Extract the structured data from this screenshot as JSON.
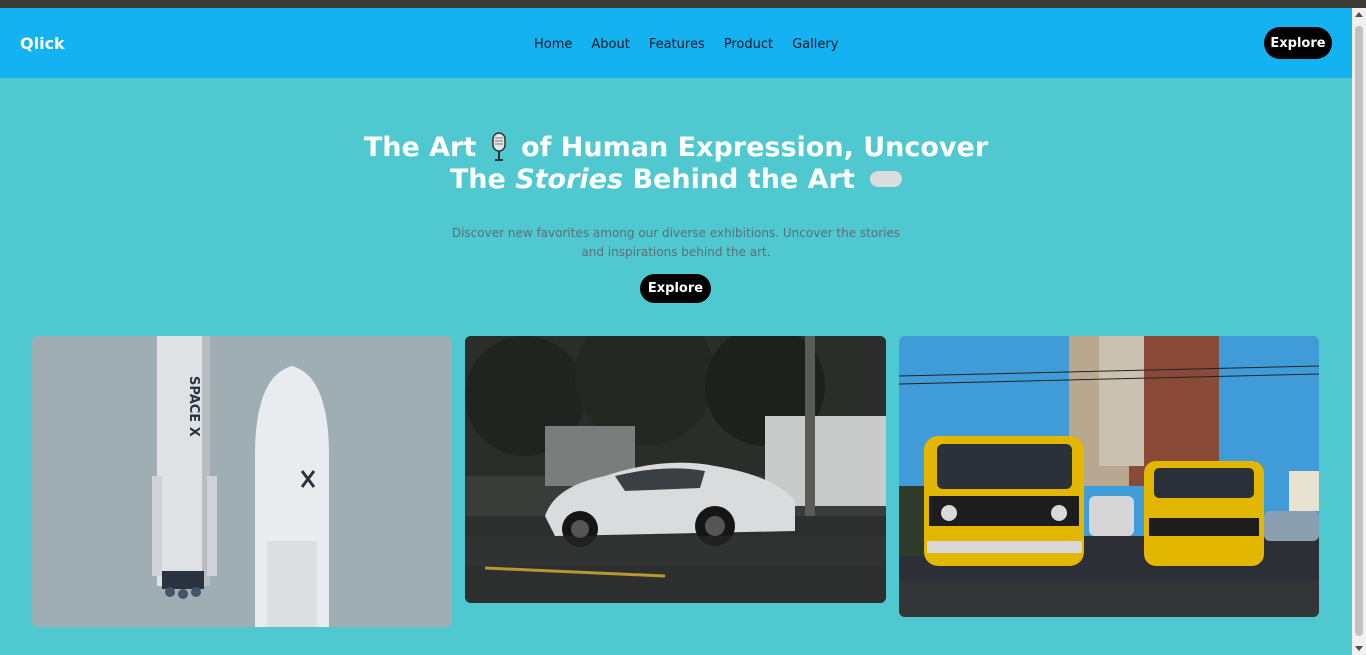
{
  "navbar": {
    "brand": "Qlick",
    "links": [
      "Home",
      "About",
      "Features",
      "Product",
      "Gallery"
    ],
    "cta_label": "Explore",
    "background": "#15b2f2"
  },
  "hero": {
    "title_part1": "The Art",
    "title_part2": "of Human Expression, Uncover",
    "title_part3": "The",
    "title_emphasis": "Stories",
    "title_part4": "Behind the Art",
    "subtitle": "Discover new favorites among our diverse exhibitions. Uncover the stories and inspirations behind the art.",
    "cta_label": "Explore",
    "background": "#4fc8d0"
  },
  "gallery": {
    "images": [
      {
        "subject": "rocket-photo"
      },
      {
        "subject": "car-photo"
      },
      {
        "subject": "buses-photo"
      }
    ]
  },
  "icons": {
    "hero_icon": "microphone-icon",
    "hero_trailing": "toggle-pill-icon"
  }
}
